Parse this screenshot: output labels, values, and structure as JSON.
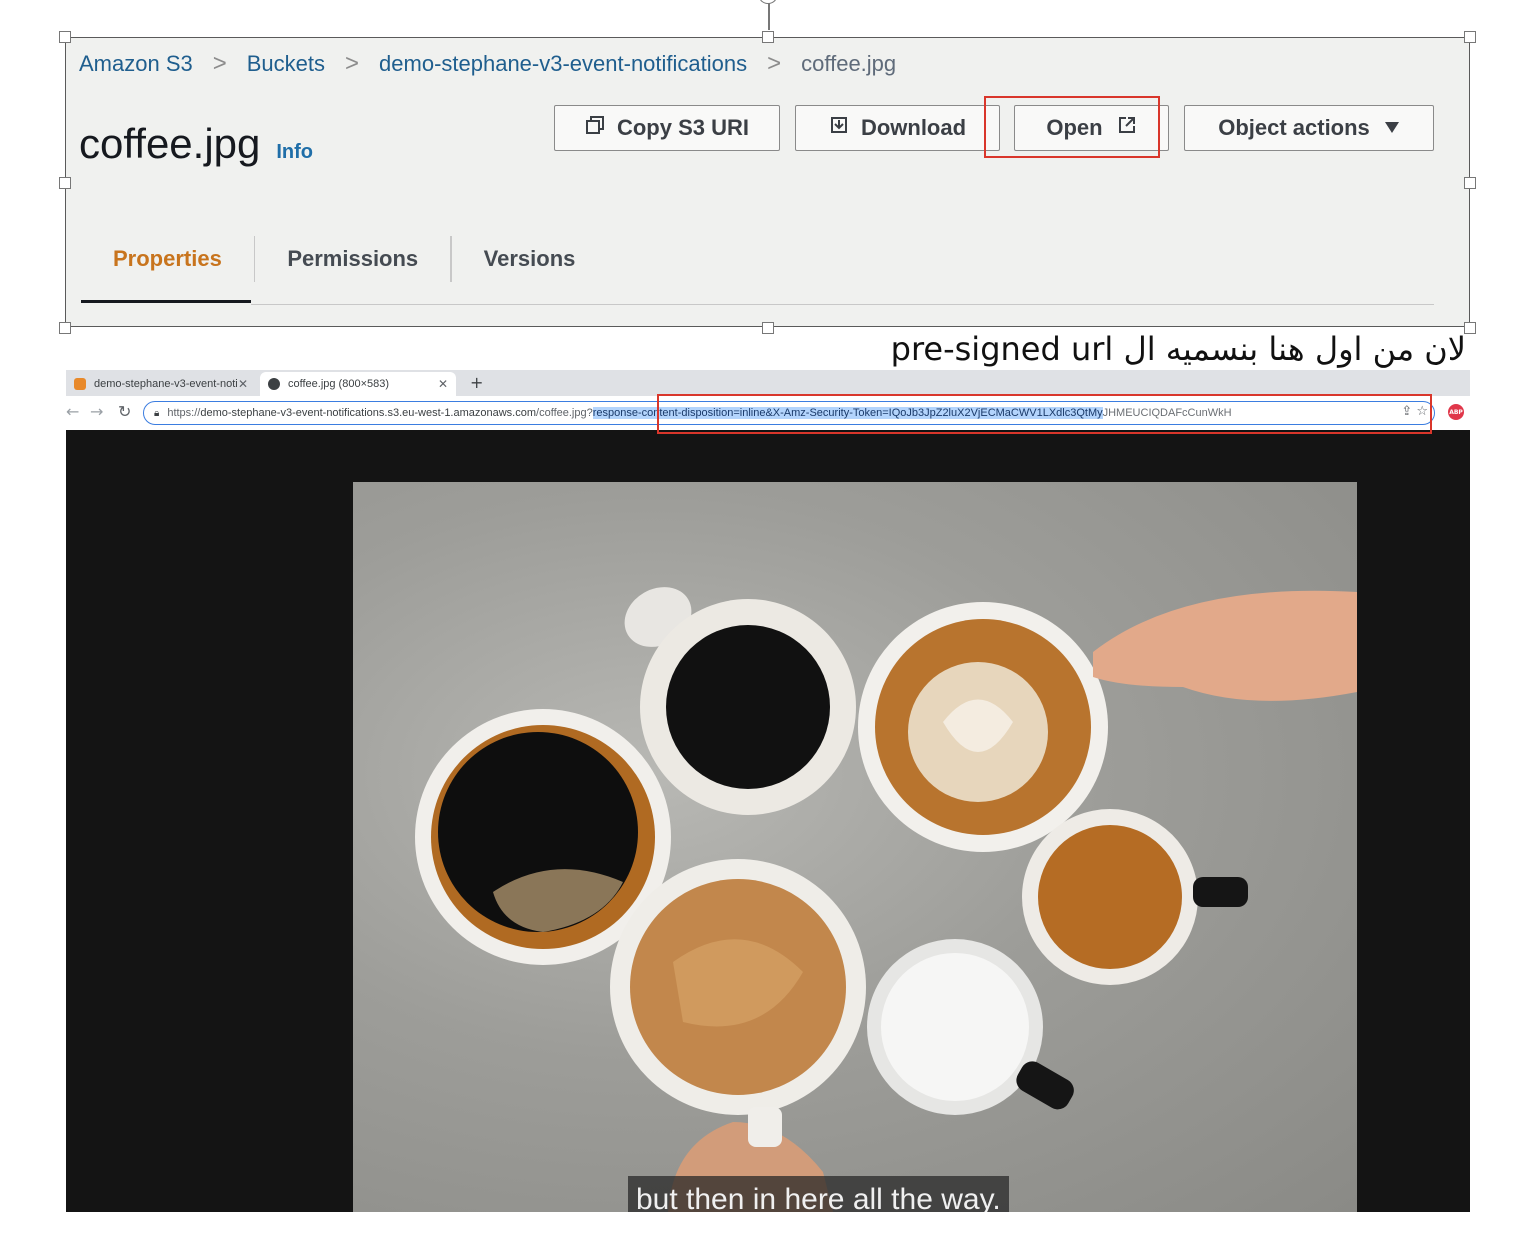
{
  "breadcrumb": {
    "items": [
      "Amazon S3",
      "Buckets",
      "demo-stephane-v3-event-notifications"
    ],
    "current": "coffee.jpg",
    "separator": ">"
  },
  "header": {
    "title": "coffee.jpg",
    "info_label": "Info"
  },
  "actions": {
    "copy_uri": "Copy S3 URI",
    "download": "Download",
    "open": "Open",
    "object_actions": "Object actions"
  },
  "tabs": [
    {
      "label": "Properties",
      "active": true
    },
    {
      "label": "Permissions",
      "active": false
    },
    {
      "label": "Versions",
      "active": false
    }
  ],
  "caption": {
    "text": "لان من اول هنا بنسميه ال pre-signed url"
  },
  "browser": {
    "tabs": [
      {
        "title": "demo-stephane-v3-event-noti",
        "active": false
      },
      {
        "title": "coffee.jpg (800×583)",
        "active": true
      }
    ],
    "url_prefix": "https://",
    "url_host": "demo-stephane-v3-event-notifications.s3.eu-west-1.amazonaws.com",
    "url_path": "/coffee.jpg?",
    "url_selected": "response-content-disposition=inline&X-Amz-Security-Token=IQoJb3JpZ2luX2VjECMaCWV1LXdlc3QtMy",
    "url_tail": "JHMEUCIQDAFcCunWkH",
    "new_tab": "+"
  },
  "subtitle": {
    "text": "but then in here all the way."
  },
  "colors": {
    "accent_active_tab": "#c8741d",
    "link": "#1f5e8e",
    "highlight_box": "#d9362b",
    "url_selection": "#b3d4fc"
  },
  "icons": {
    "copy": "copy-icon",
    "download": "download-icon",
    "open_external": "external-link-icon",
    "dropdown": "caret-down-icon"
  }
}
